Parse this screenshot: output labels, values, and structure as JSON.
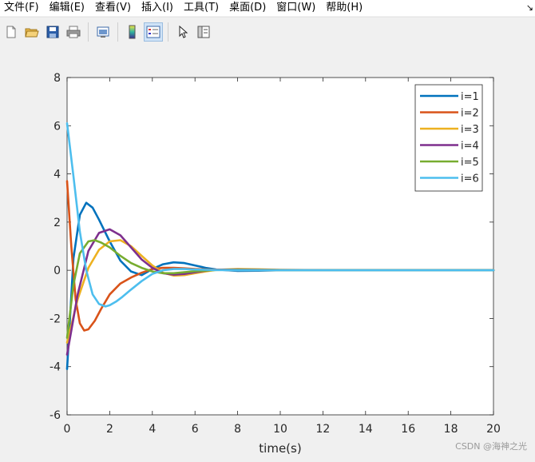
{
  "menu": {
    "items": [
      {
        "name": "menu-file",
        "label": "文件(F)"
      },
      {
        "name": "menu-edit",
        "label": "编辑(E)"
      },
      {
        "name": "menu-view",
        "label": "查看(V)"
      },
      {
        "name": "menu-insert",
        "label": "插入(I)"
      },
      {
        "name": "menu-tools",
        "label": "工具(T)"
      },
      {
        "name": "menu-desktop",
        "label": "桌面(D)"
      },
      {
        "name": "menu-window",
        "label": "窗口(W)"
      },
      {
        "name": "menu-help",
        "label": "帮助(H)"
      }
    ],
    "extra": "↘"
  },
  "toolbar": {
    "icons": [
      "new-file-icon",
      "open-folder-icon",
      "save-icon",
      "print-icon",
      "print-preview-icon",
      "colorbar-icon",
      "legend-icon",
      "pointer-icon",
      "property-editor-icon"
    ]
  },
  "watermark": "CSDN @海神之光",
  "chart_data": {
    "type": "line",
    "title": "",
    "xlabel": "time(s)",
    "ylabel": "",
    "xlim": [
      0,
      20
    ],
    "ylim": [
      -6,
      8
    ],
    "xticks": [
      0,
      2,
      4,
      6,
      8,
      10,
      12,
      14,
      16,
      18,
      20
    ],
    "yticks": [
      -6,
      -4,
      -2,
      0,
      2,
      4,
      6,
      8
    ],
    "grid": false,
    "legend_position": "top-right",
    "series": [
      {
        "name": "i=1",
        "color": "#0072BD",
        "x": [
          0,
          0.3,
          0.6,
          0.9,
          1.2,
          1.5,
          2.0,
          2.5,
          3.0,
          3.5,
          4.0,
          4.5,
          5.0,
          5.5,
          6.0,
          6.5,
          7.0,
          8.0,
          9.0,
          10.0,
          12.0,
          15.0,
          20.0
        ],
        "y": [
          -4.1,
          0.5,
          2.3,
          2.8,
          2.6,
          2.1,
          1.2,
          0.4,
          -0.05,
          -0.2,
          0.05,
          0.25,
          0.33,
          0.3,
          0.2,
          0.1,
          0.03,
          -0.03,
          -0.02,
          0,
          0,
          0,
          0
        ]
      },
      {
        "name": "i=2",
        "color": "#D95319",
        "x": [
          0,
          0.2,
          0.4,
          0.6,
          0.8,
          1.0,
          1.3,
          1.6,
          2.0,
          2.5,
          3.0,
          3.5,
          4.0,
          4.5,
          5.0,
          5.5,
          6.0,
          7.0,
          8.0,
          10.0,
          12.0,
          15.0,
          20.0
        ],
        "y": [
          3.7,
          1.0,
          -1.2,
          -2.2,
          -2.5,
          -2.45,
          -2.1,
          -1.6,
          -1.0,
          -0.55,
          -0.3,
          -0.1,
          0.05,
          0.1,
          0.1,
          0.08,
          0.05,
          0.02,
          0,
          0,
          0,
          0,
          0
        ]
      },
      {
        "name": "i=3",
        "color": "#EDB120",
        "x": [
          0,
          0.5,
          1.0,
          1.5,
          2.0,
          2.5,
          3.0,
          3.5,
          4.0,
          4.5,
          5.0,
          5.5,
          6.0,
          6.5,
          7.0,
          8.0,
          9.0,
          10.0,
          12.0,
          15.0,
          20.0
        ],
        "y": [
          -3.0,
          -1.2,
          0.1,
          0.85,
          1.2,
          1.25,
          1.0,
          0.6,
          0.2,
          -0.1,
          -0.22,
          -0.2,
          -0.12,
          -0.05,
          0.02,
          0.05,
          0.04,
          0.02,
          0,
          0,
          0
        ]
      },
      {
        "name": "i=4",
        "color": "#7E2F8E",
        "x": [
          0,
          0.5,
          1.0,
          1.5,
          2.0,
          2.5,
          3.0,
          3.5,
          4.0,
          4.5,
          5.0,
          5.5,
          6.0,
          6.5,
          7.0,
          8.0,
          9.0,
          10.0,
          12.0,
          15.0,
          20.0
        ],
        "y": [
          -3.5,
          -1.0,
          0.8,
          1.55,
          1.7,
          1.45,
          0.95,
          0.45,
          0.1,
          -0.12,
          -0.18,
          -0.15,
          -0.08,
          -0.02,
          0.02,
          0.03,
          0.02,
          0.01,
          0,
          0,
          0
        ]
      },
      {
        "name": "i=5",
        "color": "#77AC30",
        "x": [
          0,
          0.3,
          0.6,
          1.0,
          1.3,
          1.6,
          2.0,
          2.5,
          3.0,
          3.5,
          4.0,
          4.5,
          5.0,
          5.5,
          6.0,
          7.0,
          8.0,
          10.0,
          12.0,
          15.0,
          20.0
        ],
        "y": [
          -2.8,
          -0.6,
          0.7,
          1.2,
          1.25,
          1.15,
          0.95,
          0.6,
          0.3,
          0.1,
          -0.05,
          -0.12,
          -0.12,
          -0.08,
          -0.04,
          0.01,
          0.02,
          0,
          0,
          0,
          0
        ]
      },
      {
        "name": "i=6",
        "color": "#4DBEEE",
        "x": [
          0,
          0.3,
          0.6,
          0.9,
          1.2,
          1.5,
          1.8,
          2.0,
          2.3,
          2.6,
          3.0,
          3.5,
          4.0,
          4.5,
          5.0,
          5.5,
          6.0,
          7.0,
          8.0,
          10.0,
          12.0,
          15.0,
          20.0
        ],
        "y": [
          6.1,
          3.9,
          1.6,
          0.0,
          -1.0,
          -1.4,
          -1.5,
          -1.45,
          -1.3,
          -1.1,
          -0.8,
          -0.45,
          -0.15,
          0.0,
          0.05,
          0.05,
          0.03,
          0.01,
          0,
          0,
          0,
          0,
          0
        ]
      }
    ]
  }
}
